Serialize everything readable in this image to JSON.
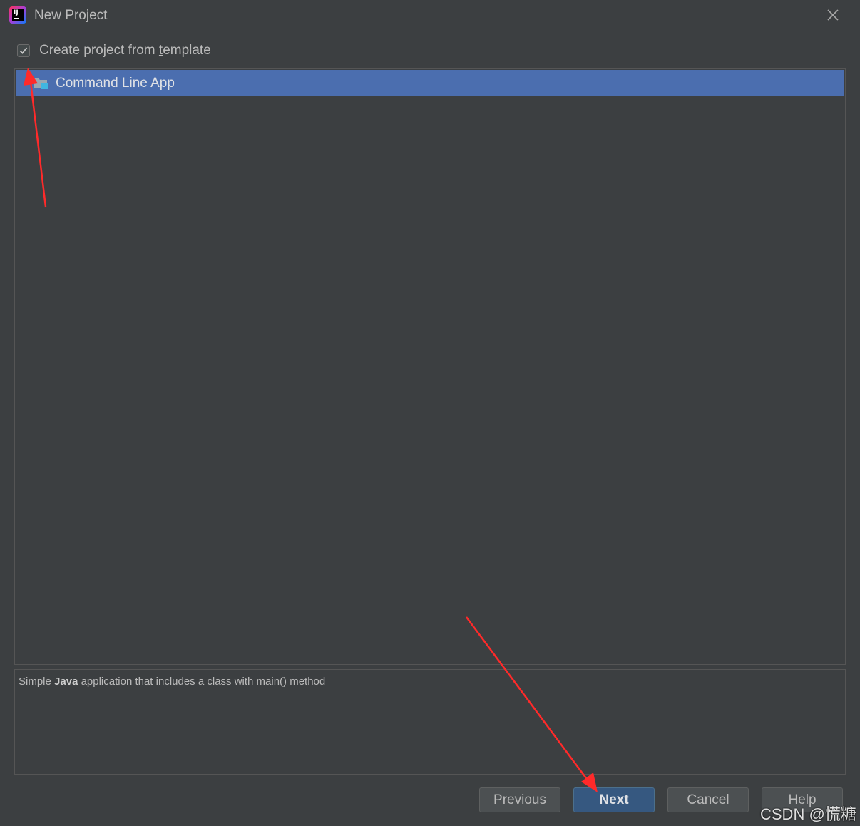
{
  "window": {
    "title": "New Project",
    "close_icon": "close-icon",
    "logo_text": "IJ"
  },
  "template_option": {
    "checked": true,
    "label_prefix": "Create project from ",
    "label_mnemonic": "t",
    "label_suffix": "emplate"
  },
  "template_list": {
    "items": [
      {
        "label": "Command Line App",
        "icon": "folder-icon",
        "selected": true
      }
    ]
  },
  "description": {
    "prefix": "Simple ",
    "bold": "Java",
    "suffix": " application that includes a class with main() method"
  },
  "buttons": {
    "previous": {
      "mnemonic": "P",
      "rest": "revious"
    },
    "next": {
      "mnemonic": "N",
      "rest": "ext"
    },
    "cancel": {
      "label": "Cancel"
    },
    "help": {
      "label": "Help"
    }
  },
  "watermark": "CSDN @慌糖",
  "colors": {
    "background": "#3c3f41",
    "selection": "#4b6eaf",
    "primary_button": "#365880",
    "annotation_arrow": "#ff2a2a"
  }
}
